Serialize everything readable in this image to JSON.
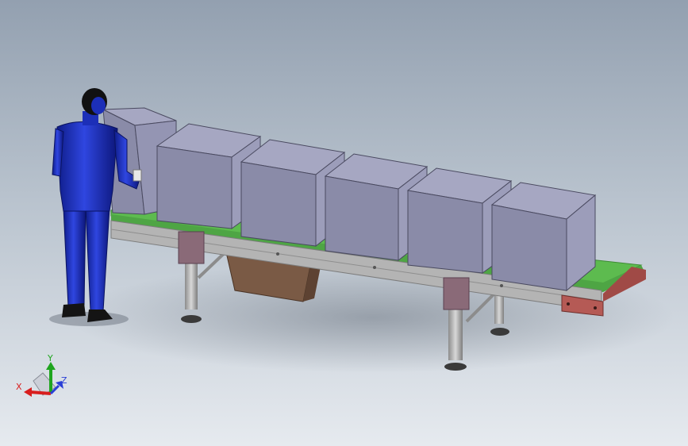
{
  "scene": {
    "background_top": "#93a0b0",
    "background_bottom": "#e6eaef",
    "belt_color": "#5dbb4f",
    "box_face": "#8a8ba8",
    "box_top": "#a6a7c2",
    "frame_color": "#b4b4b4",
    "leg_bracket_color": "#8a6a78",
    "hopper_color": "#7a5a45",
    "figure_color": "#1c2fb8"
  },
  "triad": {
    "x_label": "X",
    "y_label": "Y",
    "z_label": "Z",
    "x_color": "#d81e1e",
    "y_color": "#1fa51f",
    "z_color": "#2a3fd6"
  }
}
